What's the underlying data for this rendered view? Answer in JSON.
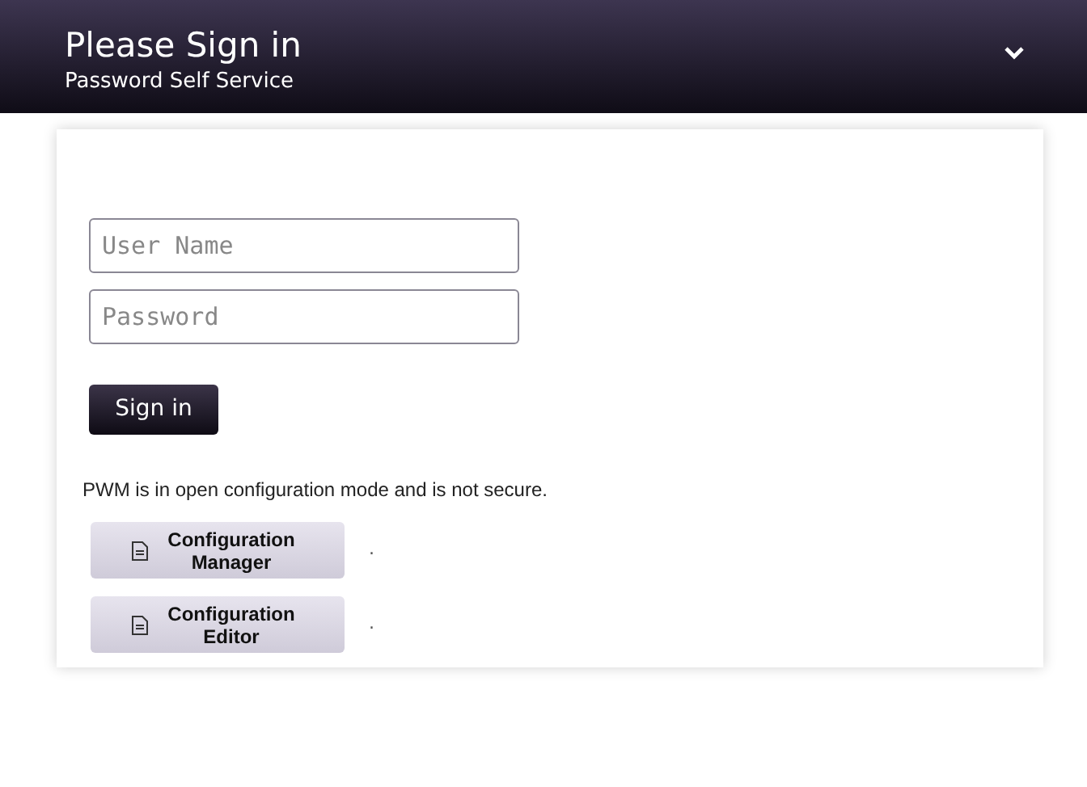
{
  "header": {
    "title": "Please Sign in",
    "subtitle": "Password Self Service",
    "menu_toggle": {
      "expanded": false
    }
  },
  "form": {
    "fields": [
      {
        "placeholder": "User Name"
      },
      {
        "placeholder": "Password"
      }
    ],
    "submit": "Sign in"
  },
  "notice": "PWM is in open configuration mode and is not secure.",
  "config_buttons": [
    {
      "label": "Configuration Manager",
      "note": "."
    },
    {
      "label": "Configuration Editor",
      "note": "."
    }
  ]
}
